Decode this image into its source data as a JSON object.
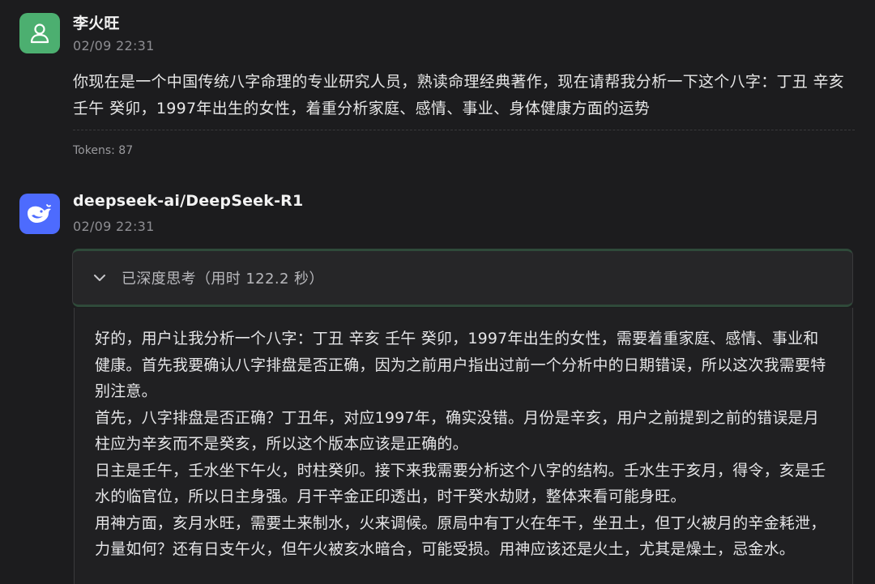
{
  "conversation": {
    "user_message": {
      "sender": "李火旺",
      "timestamp": "02/09 22:31",
      "text": "你现在是一个中国传统八字命理的专业研究人员，熟读命理经典著作，现在请帮我分析一下这个八字：丁丑 辛亥 壬午 癸卯，1997年出生的女性，着重分析家庭、感情、事业、身体健康方面的运势",
      "tokens": "Tokens: 87",
      "avatar_icon": "user-icon",
      "avatar_color": "#4caf70"
    },
    "ai_message": {
      "sender": "deepseek-ai/DeepSeek-R1",
      "timestamp": "02/09 22:31",
      "avatar_icon": "deepseek-whale-icon",
      "avatar_color": "#4d6bfe",
      "think_header": "已深度思考（用时 122.2 秒）",
      "think_paragraphs": [
        "好的，用户让我分析一个八字：丁丑 辛亥 壬午 癸卯，1997年出生的女性，需要着重家庭、感情、事业和健康。首先我要确认八字排盘是否正确，因为之前用户指出过前一个分析中的日期错误，所以这次我需要特别注意。",
        "首先，八字排盘是否正确？丁丑年，对应1997年，确实没错。月份是辛亥，用户之前提到之前的错误是月柱应为辛亥而不是癸亥，所以这个版本应该是正确的。",
        "日主是壬午，壬水坐下午火，时柱癸卯。接下来我需要分析这个八字的结构。壬水生于亥月，得令，亥是壬水的临官位，所以日主身强。月干辛金正印透出，时干癸水劫财，整体来看可能身旺。",
        "用神方面，亥月水旺，需要土来制水，火来调候。原局中有丁火在年干，坐丑土，但丁火被月的辛金耗泄，力量如何？还有日支午火，但午火被亥水暗合，可能受损。用神应该还是火土，尤其是燥土，忌金水。"
      ]
    }
  }
}
